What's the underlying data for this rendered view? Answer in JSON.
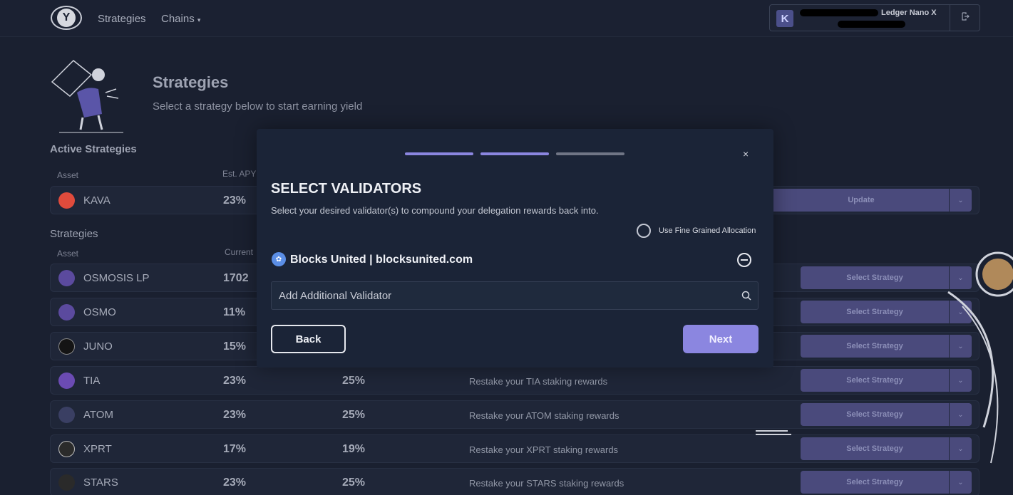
{
  "header": {
    "logo_letter": "Y",
    "nav": {
      "strategies": "Strategies",
      "chains": "Chains",
      "chains_caret": "˅"
    },
    "wallet": {
      "avatar_letter": "K",
      "name": "Ledger Nano X",
      "logout_icon": "logout-icon"
    }
  },
  "hero": {
    "title": "Strategies",
    "subtitle": "Select a strategy below to start earning yield"
  },
  "active": {
    "title": "Active Strategies",
    "col_asset": "Asset",
    "col_apy": "Est. APY",
    "rows": [
      {
        "asset": "KAVA",
        "apy": "23%",
        "button": "Update",
        "icon_color": "#e04b3c"
      }
    ]
  },
  "strategies": {
    "title": "Strategies",
    "col_asset": "Asset",
    "col_current": "Current",
    "select_label": "Select Strategy",
    "rows": [
      {
        "asset": "OSMOSIS LP",
        "apy": "1702",
        "current": "",
        "desc": "",
        "icon_color": "#5b4a9e"
      },
      {
        "asset": "OSMO",
        "apy": "11%",
        "current": "",
        "desc": "",
        "icon_color": "#5b4a9e"
      },
      {
        "asset": "JUNO",
        "apy": "15%",
        "current": "",
        "desc": "",
        "icon_color": "#141414"
      },
      {
        "asset": "TIA",
        "apy": "23%",
        "current": "25%",
        "desc": "Restake your TIA staking rewards",
        "icon_color": "#6b4bb3"
      },
      {
        "asset": "ATOM",
        "apy": "23%",
        "current": "25%",
        "desc": "Restake your ATOM staking rewards",
        "icon_color": "#3a3f63"
      },
      {
        "asset": "XPRT",
        "apy": "17%",
        "current": "19%",
        "desc": "Restake your XPRT staking rewards",
        "icon_color": "#2b2b2b"
      },
      {
        "asset": "STARS",
        "apy": "23%",
        "current": "25%",
        "desc": "Restake your STARS staking rewards",
        "icon_color": "#2a2a2a"
      }
    ]
  },
  "modal": {
    "title": "SELECT VALIDATORS",
    "subtitle": "Select your desired validator(s) to compound your delegation rewards back into.",
    "fine_grained_label": "Use Fine Grained Allocation",
    "close": "×",
    "validator": {
      "name": "Blocks United | blocksunited.com"
    },
    "search_placeholder": "Add Additional Validator",
    "back_label": "Back",
    "next_label": "Next"
  }
}
